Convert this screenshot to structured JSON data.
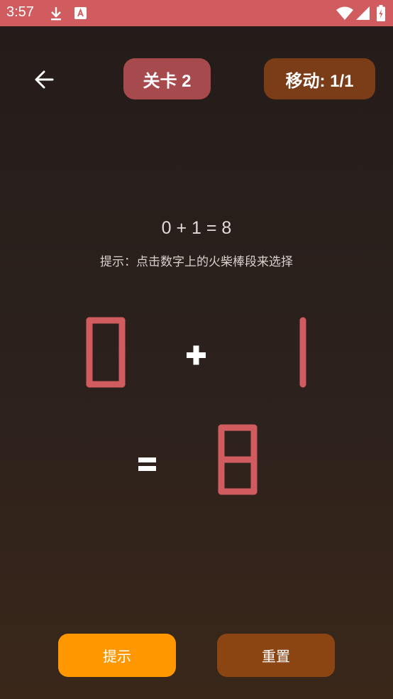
{
  "status_bar": {
    "time": "3:57",
    "icons": [
      "download-icon",
      "font-app-icon",
      "wifi-icon",
      "signal-icon",
      "battery-icon"
    ],
    "color": "#d05c5f"
  },
  "header": {
    "back_icon": "arrow-left-icon",
    "level_label": "关卡 2",
    "moves_label": "移动: 1/1"
  },
  "puzzle": {
    "equation": "0 + 1 = 8",
    "hint": "提示：点击数字上的火柴棒段来选择",
    "first_digit": "0",
    "operator": "+",
    "second_digit": "1",
    "equals": "=",
    "result_digit": "8",
    "matchstick_color": "#d05c5f"
  },
  "actions": {
    "hint_button": "提示",
    "reset_button": "重置"
  },
  "colors": {
    "accent_hint": "#ff9800",
    "accent_reset": "#8b4513",
    "level_pill": "#a64a4d",
    "moves_pill": "#7a3d18"
  }
}
